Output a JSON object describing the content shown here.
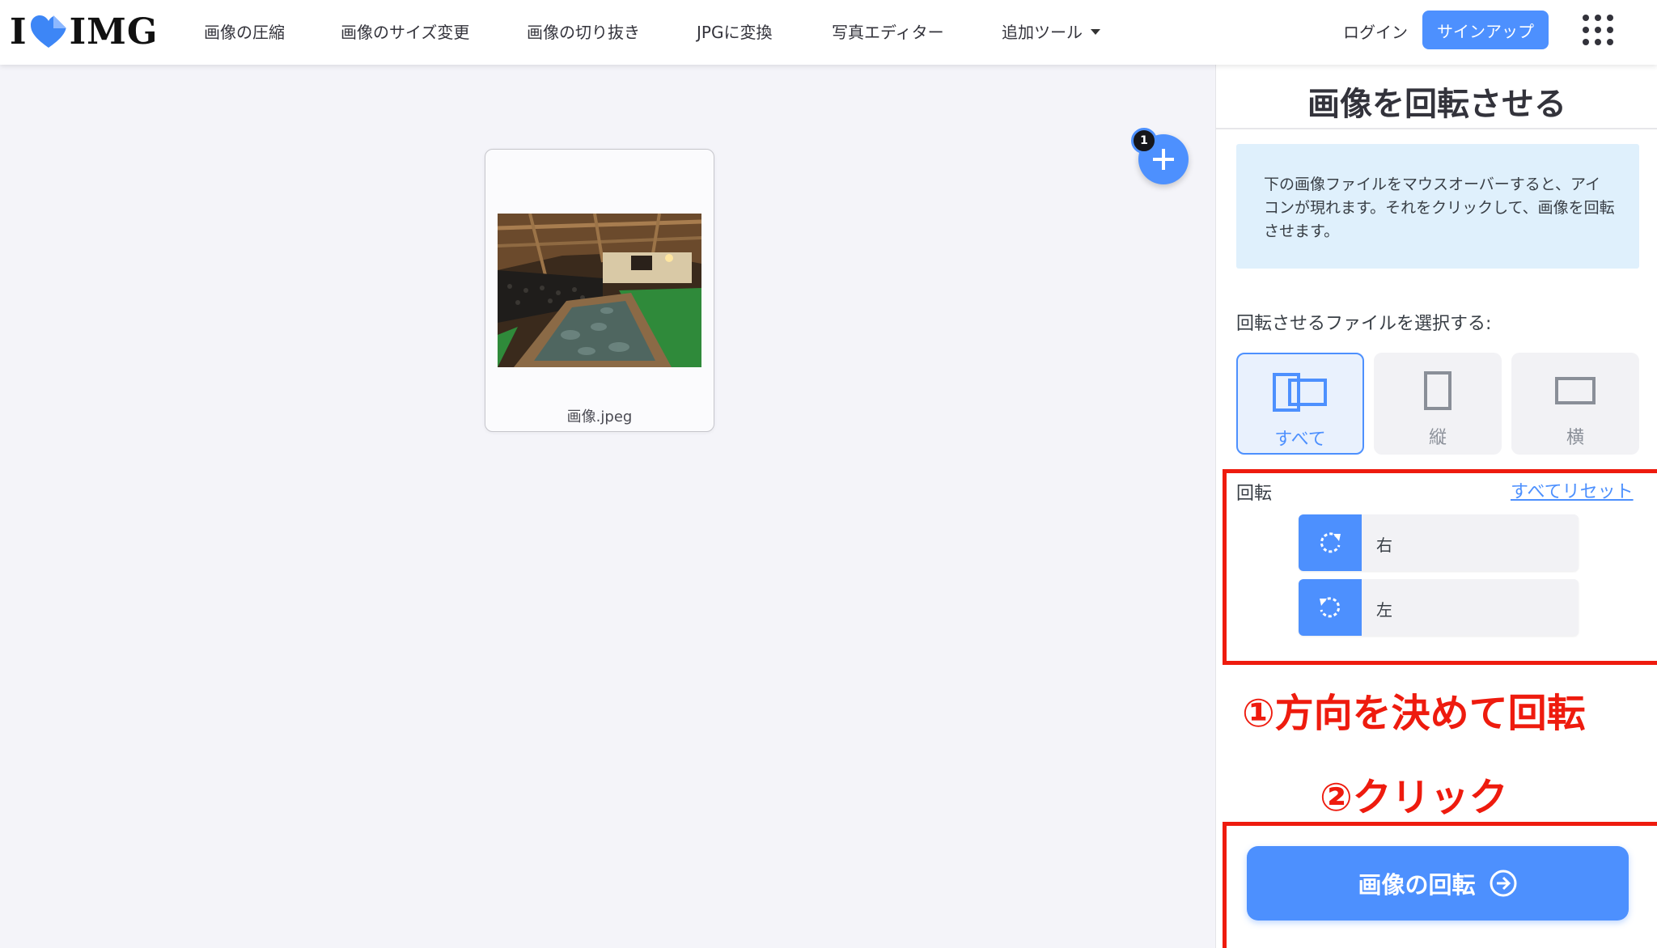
{
  "header": {
    "logo_left": "I",
    "logo_right": "IMG",
    "nav": [
      {
        "label": "画像の圧縮"
      },
      {
        "label": "画像のサイズ変更"
      },
      {
        "label": "画像の切り抜き"
      },
      {
        "label": "JPGに変換"
      },
      {
        "label": "写真エディター"
      },
      {
        "label": "追加ツール"
      }
    ],
    "login": "ログイン",
    "signup": "サインアップ",
    "apps_icon": "grid-icon"
  },
  "workspace": {
    "file": {
      "name": "画像.jpeg"
    },
    "file_count": "1",
    "add_icon": "plus-icon"
  },
  "sidebar": {
    "title": "画像を回転させる",
    "info": "下の画像ファイルをマウスオーバーすると、アイコンが現れます。それをクリックして、画像を回転させます。",
    "select_label": "回転させるファイルを選択する:",
    "filters": [
      {
        "label": "すべて",
        "icon": "all-orientation-icon",
        "active": true
      },
      {
        "label": "縦",
        "icon": "portrait-icon",
        "active": false
      },
      {
        "label": "横",
        "icon": "landscape-icon",
        "active": false
      }
    ],
    "rotate_label": "回転",
    "reset_all": "すべてリセット",
    "rotate_buttons": [
      {
        "label": "右",
        "icon": "rotate-right-icon"
      },
      {
        "label": "左",
        "icon": "rotate-left-icon"
      }
    ],
    "cta": "画像の回転",
    "cta_icon": "arrow-right-circle-icon"
  },
  "annotations": {
    "step1": "①方向を決めて回転",
    "step2": "②クリック"
  },
  "colors": {
    "accent": "#4d90fe",
    "annotation": "#ee1b0e",
    "info_bg": "#dff0fc"
  }
}
